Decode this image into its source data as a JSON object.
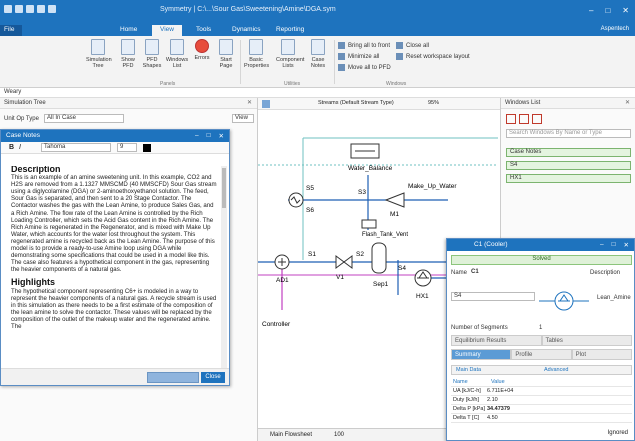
{
  "app": {
    "title": "Symmetry | C:\\...\\Sour Gas\\Sweetening\\Amine\\DGA.sym",
    "window_controls": [
      "–",
      "□",
      "✕"
    ],
    "account": "Aspentech",
    "tabs": [
      {
        "label": "File",
        "active": false
      },
      {
        "label": "Home",
        "active": false
      },
      {
        "label": "View",
        "active": true
      },
      {
        "label": "Tools",
        "active": false
      },
      {
        "label": "Dynamics",
        "active": false
      },
      {
        "label": "Reporting",
        "active": false
      }
    ]
  },
  "ribbon": {
    "buttons": [
      {
        "label": "Simulation Tree"
      },
      {
        "label": "Show PFD"
      },
      {
        "label": "PFD Shapes"
      },
      {
        "label": "Windows List"
      },
      {
        "label": "Errors"
      },
      {
        "label": "Start Page"
      },
      {
        "label": "Basic Properties"
      },
      {
        "label": "Component Lists"
      },
      {
        "label": "Case Notes"
      }
    ],
    "small_items": [
      {
        "label": "Bring all to front"
      },
      {
        "label": "Close all"
      },
      {
        "label": "Minimize all"
      },
      {
        "label": "Reset workspace layout"
      },
      {
        "label": "Move all to PFD"
      }
    ],
    "groups": [
      "Panels",
      "Utilities",
      "Windows"
    ]
  },
  "breadcrumb": "Weary",
  "sim_tree": {
    "title": "Simulation Tree",
    "unit_op_type_label": "Unit Op Type",
    "unit_op_type_value": "All In Case",
    "filter_value": "View"
  },
  "canvas": {
    "zoom": "95%",
    "streams_combo": "Streams (Default Stream Type)",
    "bottom_tab": "Main Flowsheet",
    "bottom_zoom": "100",
    "labels": {
      "water_balance": "Water_Balance",
      "make_up_water": "Make_Up_Water",
      "flash_tank": "Flash_Tank_Vent",
      "sep1": "Sep1",
      "controller": "Controller",
      "s5": "S5",
      "s6": "S6",
      "s3": "S3",
      "s1": "S1",
      "s4": "S4",
      "s2": "S2",
      "m1": "M1",
      "v1": "V1",
      "ad1": "AD1",
      "hx1": "HX1"
    }
  },
  "windows_list": {
    "title": "Windows List",
    "search_placeholder": "Search Windows By Name or Type",
    "items": [
      {
        "label": "Case Notes"
      },
      {
        "label": "S4"
      },
      {
        "label": "HX1"
      }
    ]
  },
  "notes": {
    "title": "Case Notes",
    "font": "Tahoma",
    "font_size": "9",
    "description_heading": "Description",
    "description": "This is an example of an amine sweetening unit. In this example, CO2 and H2S are removed from a 1.1327 MMSCMD (40 MMSCFD) Sour Gas stream using a diglycolamine (DGA) or 2-aminoethoxyethanol solution. The feed, Sour Gas is separated, and then sent to a 20 Stage Contactor. The Contactor washes the gas with the Lean Amine, to produce Sales Gas, and a Rich Amine. The flow rate of the Lean Amine is controlled by the Rich Loading Controller, which sets the Acid Gas content in the Rich Amine. The Rich Amine is regenerated in the Regenerator, and is mixed with Make Up Water, which accounts for the water lost throughout the system. This regenerated amine is recycled back as the Lean Amine. The purpose of this model is to provide a ready-to-use Amine loop using DGA while demonstrating some specifications that could be used in a model like this. The case also features a hypothetical component in the gas, representing the heavier components of a natural gas.",
    "highlights_heading": "Highlights",
    "highlights": "The hypothetical component representing C6+ is modeled in a way to represent the heavier components of a natural gas. A recycle stream is used in this simulation as there needs to be a first estimate of the composition of the lean amine to solve the contactor. These values will be replaced by the composition of the outlet of the makeup water and the regenerated amine. The",
    "footer_field": "",
    "close_label": "Close"
  },
  "cooler": {
    "title": "C1 (Cooler)",
    "status": "Solved",
    "name_label": "Name",
    "name_value": "C1",
    "description_label": "Description",
    "inlet": "S4",
    "outlet": "Lean_Amine",
    "segments_label": "Number of Segments",
    "segments_value": "1",
    "tabs": [
      {
        "label": "Equilibrium Results",
        "active": false
      },
      {
        "label": "Tables",
        "active": false
      },
      {
        "label": "Summary",
        "active": true
      },
      {
        "label": "Profile",
        "active": false
      },
      {
        "label": "Plot",
        "active": false
      }
    ],
    "section_main": "Main Data",
    "section_advanced": "Advanced",
    "columns": [
      "Name",
      "Value"
    ],
    "rows": [
      {
        "name": "UA [kJ/C-h]",
        "value": "6.711E+04"
      },
      {
        "name": "Duty [kJ/h]",
        "value": "2.10"
      },
      {
        "name": "Delta P [kPa]",
        "value": "34.47379"
      },
      {
        "name": "Delta T [C]",
        "value": "4.50"
      }
    ],
    "footer_status": "Ignored"
  }
}
